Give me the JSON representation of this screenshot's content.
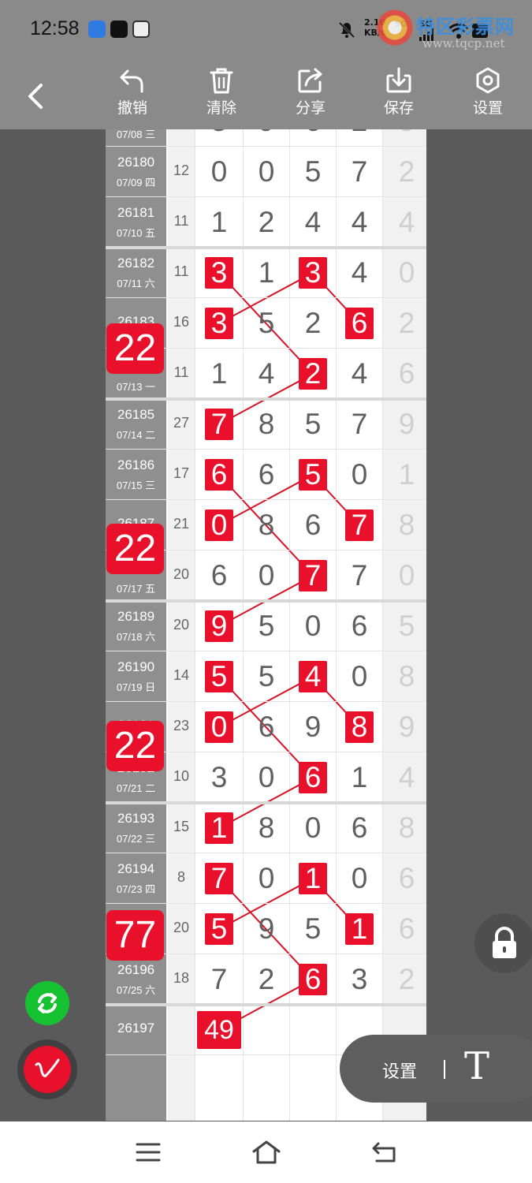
{
  "status_bar": {
    "time": "12:58",
    "net_speed_top": "2.10",
    "net_speed_bottom": "KB/s",
    "network_badge_1": "5G",
    "network_badge_2": "5G",
    "icons": [
      "message-app-icon",
      "tiktok-icon",
      "avatar-app-icon",
      "bell-muted-icon",
      "signal-icon",
      "wifi-icon",
      "battery-icon"
    ]
  },
  "watermark": {
    "title": "特区彩票网",
    "url": "www.tqcp.net"
  },
  "toolbar": {
    "undo_label": "撤销",
    "clear_label": "清除",
    "share_label": "分享",
    "save_label": "保存",
    "settings_label": "设置"
  },
  "rows": [
    {
      "issue": "",
      "date": "07/08 三",
      "sum": "",
      "d": [
        "5",
        "9",
        "6",
        "2",
        "5"
      ],
      "partial": true
    },
    {
      "issue": "26180",
      "date": "07/09 四",
      "sum": "12",
      "d": [
        "0",
        "0",
        "5",
        "7",
        "2"
      ]
    },
    {
      "issue": "26181",
      "date": "07/10 五",
      "sum": "11",
      "d": [
        "1",
        "2",
        "4",
        "4",
        "4"
      ]
    },
    {
      "issue": "26182",
      "date": "07/11 六",
      "sum": "11",
      "d": [
        "3",
        "1",
        "3",
        "4",
        "0"
      ]
    },
    {
      "issue": "26183",
      "date": "",
      "sum": "16",
      "d": [
        "3",
        "5",
        "2",
        "6",
        "2"
      ]
    },
    {
      "issue": "",
      "date": "07/13 一",
      "sum": "11",
      "d": [
        "1",
        "4",
        "2",
        "4",
        "6"
      ]
    },
    {
      "issue": "26185",
      "date": "07/14 二",
      "sum": "27",
      "d": [
        "7",
        "8",
        "5",
        "7",
        "9"
      ]
    },
    {
      "issue": "26186",
      "date": "07/15 三",
      "sum": "17",
      "d": [
        "6",
        "6",
        "5",
        "0",
        "1"
      ]
    },
    {
      "issue": "26187",
      "date": "",
      "sum": "21",
      "d": [
        "0",
        "8",
        "6",
        "7",
        "8"
      ]
    },
    {
      "issue": "",
      "date": "07/17 五",
      "sum": "20",
      "d": [
        "6",
        "0",
        "7",
        "7",
        "0"
      ]
    },
    {
      "issue": "26189",
      "date": "07/18 六",
      "sum": "20",
      "d": [
        "9",
        "5",
        "0",
        "6",
        "5"
      ]
    },
    {
      "issue": "26190",
      "date": "07/19 日",
      "sum": "14",
      "d": [
        "5",
        "5",
        "4",
        "0",
        "8"
      ]
    },
    {
      "issue": "26191",
      "date": "",
      "sum": "23",
      "d": [
        "0",
        "6",
        "9",
        "8",
        "9"
      ]
    },
    {
      "issue": "26192",
      "date": "07/21 二",
      "sum": "10",
      "d": [
        "3",
        "0",
        "6",
        "1",
        "4"
      ]
    },
    {
      "issue": "26193",
      "date": "07/22 三",
      "sum": "15",
      "d": [
        "1",
        "8",
        "0",
        "6",
        "8"
      ]
    },
    {
      "issue": "26194",
      "date": "07/23 四",
      "sum": "8",
      "d": [
        "7",
        "0",
        "1",
        "0",
        "6"
      ]
    },
    {
      "issue": "",
      "date": "",
      "sum": "20",
      "d": [
        "5",
        "9",
        "5",
        "1",
        "6"
      ]
    },
    {
      "issue": "26196",
      "date": "07/25 六",
      "sum": "18",
      "d": [
        "7",
        "2",
        "6",
        "3",
        "2"
      ]
    },
    {
      "issue": "26197",
      "date": "",
      "sum": "",
      "d": [
        "",
        "",
        "",
        "",
        ""
      ]
    }
  ],
  "highlights": [
    [
      3,
      0
    ],
    [
      3,
      2
    ],
    [
      4,
      0
    ],
    [
      4,
      3
    ],
    [
      5,
      2
    ],
    [
      6,
      0
    ],
    [
      7,
      0
    ],
    [
      7,
      2
    ],
    [
      8,
      0
    ],
    [
      8,
      3
    ],
    [
      9,
      2
    ],
    [
      10,
      0
    ],
    [
      11,
      0
    ],
    [
      11,
      2
    ],
    [
      12,
      0
    ],
    [
      12,
      3
    ],
    [
      13,
      2
    ],
    [
      14,
      0
    ],
    [
      15,
      0
    ],
    [
      15,
      2
    ],
    [
      16,
      0
    ],
    [
      16,
      3
    ],
    [
      17,
      2
    ]
  ],
  "forecast_value": "49",
  "group_badges": [
    "22",
    "22",
    "22",
    "77"
  ],
  "floating": {
    "settings_label": "设置",
    "text_tool_label": "T"
  },
  "colors": {
    "highlight": "#e8102a",
    "refresh_button": "#16c232",
    "toolbar_bg": "#8a8a8a"
  }
}
